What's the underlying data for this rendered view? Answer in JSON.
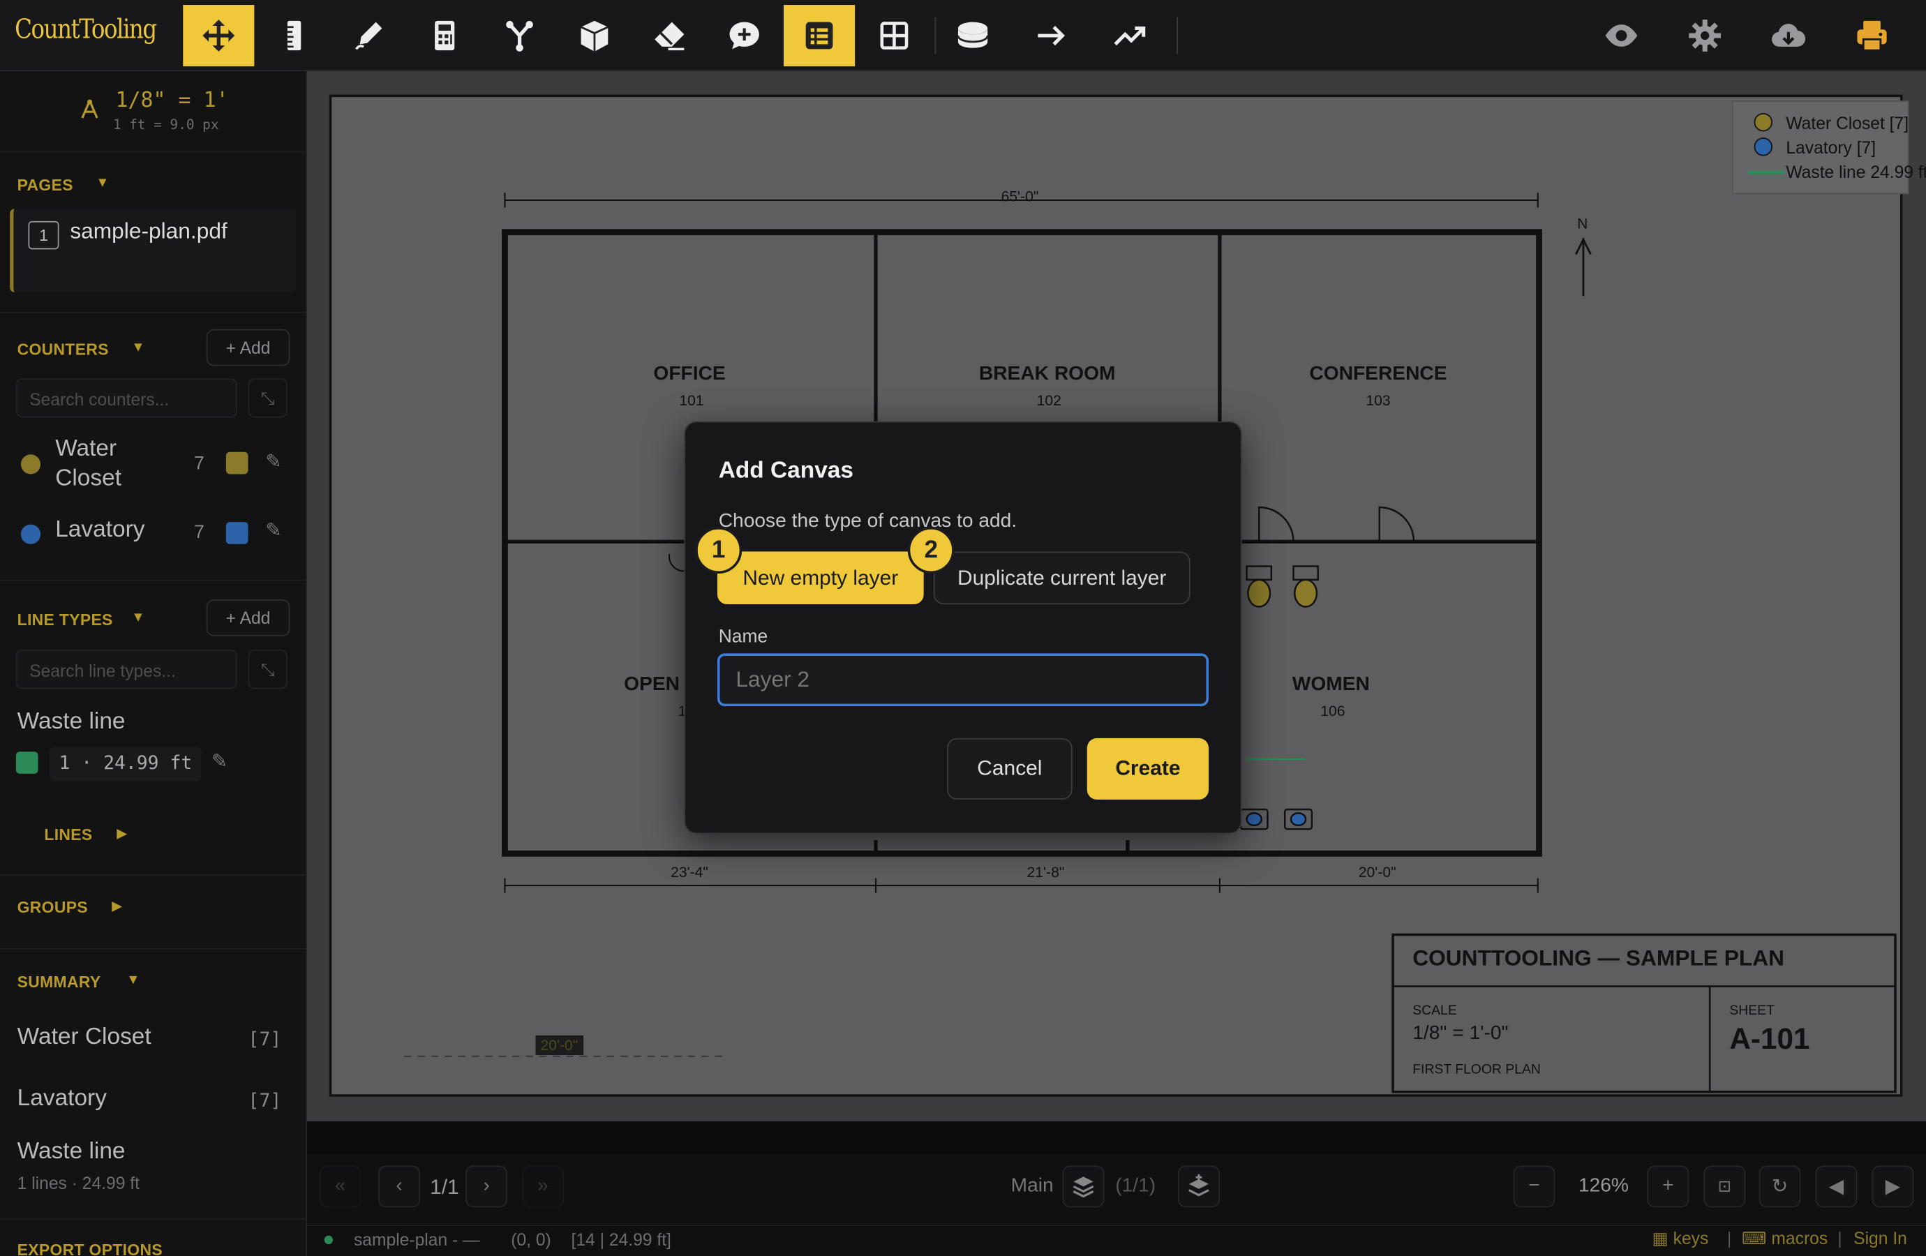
{
  "app": {
    "logo": "CountTooling"
  },
  "toolbar": {
    "tools": [
      {
        "name": "move-icon",
        "active": true
      },
      {
        "name": "ruler-icon",
        "active": false
      },
      {
        "name": "pen-icon",
        "active": false
      },
      {
        "name": "calculator-icon",
        "active": false
      },
      {
        "name": "branch-icon",
        "active": false
      },
      {
        "name": "cube-icon",
        "active": false
      },
      {
        "name": "eraser-icon",
        "active": false
      },
      {
        "name": "comment-icon",
        "active": false
      },
      {
        "name": "list-icon",
        "active": true
      },
      {
        "name": "grid-icon",
        "active": false
      },
      {
        "name": "database-icon",
        "active": false
      },
      {
        "name": "arrow-right-icon",
        "active": false
      },
      {
        "name": "trend-icon",
        "active": false
      }
    ],
    "right_tools": [
      "eye-icon",
      "gear-icon",
      "cloud-download-icon",
      "printer-icon"
    ]
  },
  "scale": {
    "label": "1/8\" = 1'",
    "sub": "1 ft = 9.0 px"
  },
  "pages": {
    "header": "PAGES",
    "items": [
      {
        "number": "1",
        "name": "sample-plan.pdf"
      }
    ]
  },
  "counters": {
    "header": "COUNTERS",
    "add_label": "+ Add",
    "search_placeholder": "Search counters...",
    "items": [
      {
        "name_line1": "Water",
        "name_line2": "Closet",
        "count": "7",
        "color": "#8a7a2a"
      },
      {
        "name_line1": "Lavatory",
        "name_line2": "",
        "count": "7",
        "color": "#2d63a8"
      }
    ]
  },
  "line_types": {
    "header": "LINE TYPES",
    "add_label": "+ Add",
    "search_placeholder": "Search line types...",
    "item_name": "Waste line",
    "item_value": "1 · 24.99 ft",
    "item_color": "#2b8a57",
    "lines_label": "LINES"
  },
  "groups": {
    "header": "GROUPS"
  },
  "summary": {
    "header": "SUMMARY",
    "rows": [
      {
        "label": "Water Closet",
        "count": "[7]"
      },
      {
        "label": "Lavatory",
        "count": "[7]"
      }
    ],
    "waste_label": "Waste line",
    "waste_sub": "1 lines · 24.99 ft"
  },
  "export": {
    "header": "EXPORT OPTIONS"
  },
  "legend": {
    "items": [
      {
        "label": "Water Closet [7]",
        "color": "#8a7a2a"
      },
      {
        "label": "Lavatory [7]",
        "color": "#2d63a8"
      },
      {
        "label": "Waste line 24.99 ft",
        "color": "#2b8a57"
      }
    ]
  },
  "plan": {
    "dim_top": "65'-0\"",
    "rooms": [
      {
        "name": "OFFICE",
        "num": "101"
      },
      {
        "name": "BREAK ROOM",
        "num": "102"
      },
      {
        "name": "CONFERENCE",
        "num": "103"
      },
      {
        "name": "OPEN",
        "num": "1"
      },
      {
        "name": "WOMEN",
        "num": "106"
      }
    ],
    "dims_bottom": [
      "23'-4\"",
      "21'-8\"",
      "20'-0\""
    ],
    "north": "N",
    "measure_label": "20'-0\"",
    "title_block": {
      "title": "COUNTTOOLING — SAMPLE PLAN",
      "scale_label": "SCALE",
      "scale_value": "1/8\" = 1'-0\"",
      "plan_name": "FIRST FLOOR PLAN",
      "sheet_label": "SHEET",
      "sheet_value": "A-101"
    }
  },
  "bottom": {
    "page_indicator": "1/1",
    "layer_name": "Main",
    "layer_count": "(1/1)",
    "zoom": "126%",
    "status_file": "sample-plan - —",
    "status_coords": "(0, 0)",
    "status_extra": "[14 | 24.99 ft]",
    "keys_label": "keys",
    "macros_label": "macros",
    "sep": "|",
    "signin_label": "Sign In"
  },
  "modal": {
    "title": "Add Canvas",
    "subtitle": "Choose the type of canvas to add.",
    "option1": "New empty layer",
    "option2": "Duplicate current layer",
    "badge1": "1",
    "badge2": "2",
    "name_label": "Name",
    "name_placeholder": "Layer 2",
    "cancel": "Cancel",
    "create": "Create"
  }
}
